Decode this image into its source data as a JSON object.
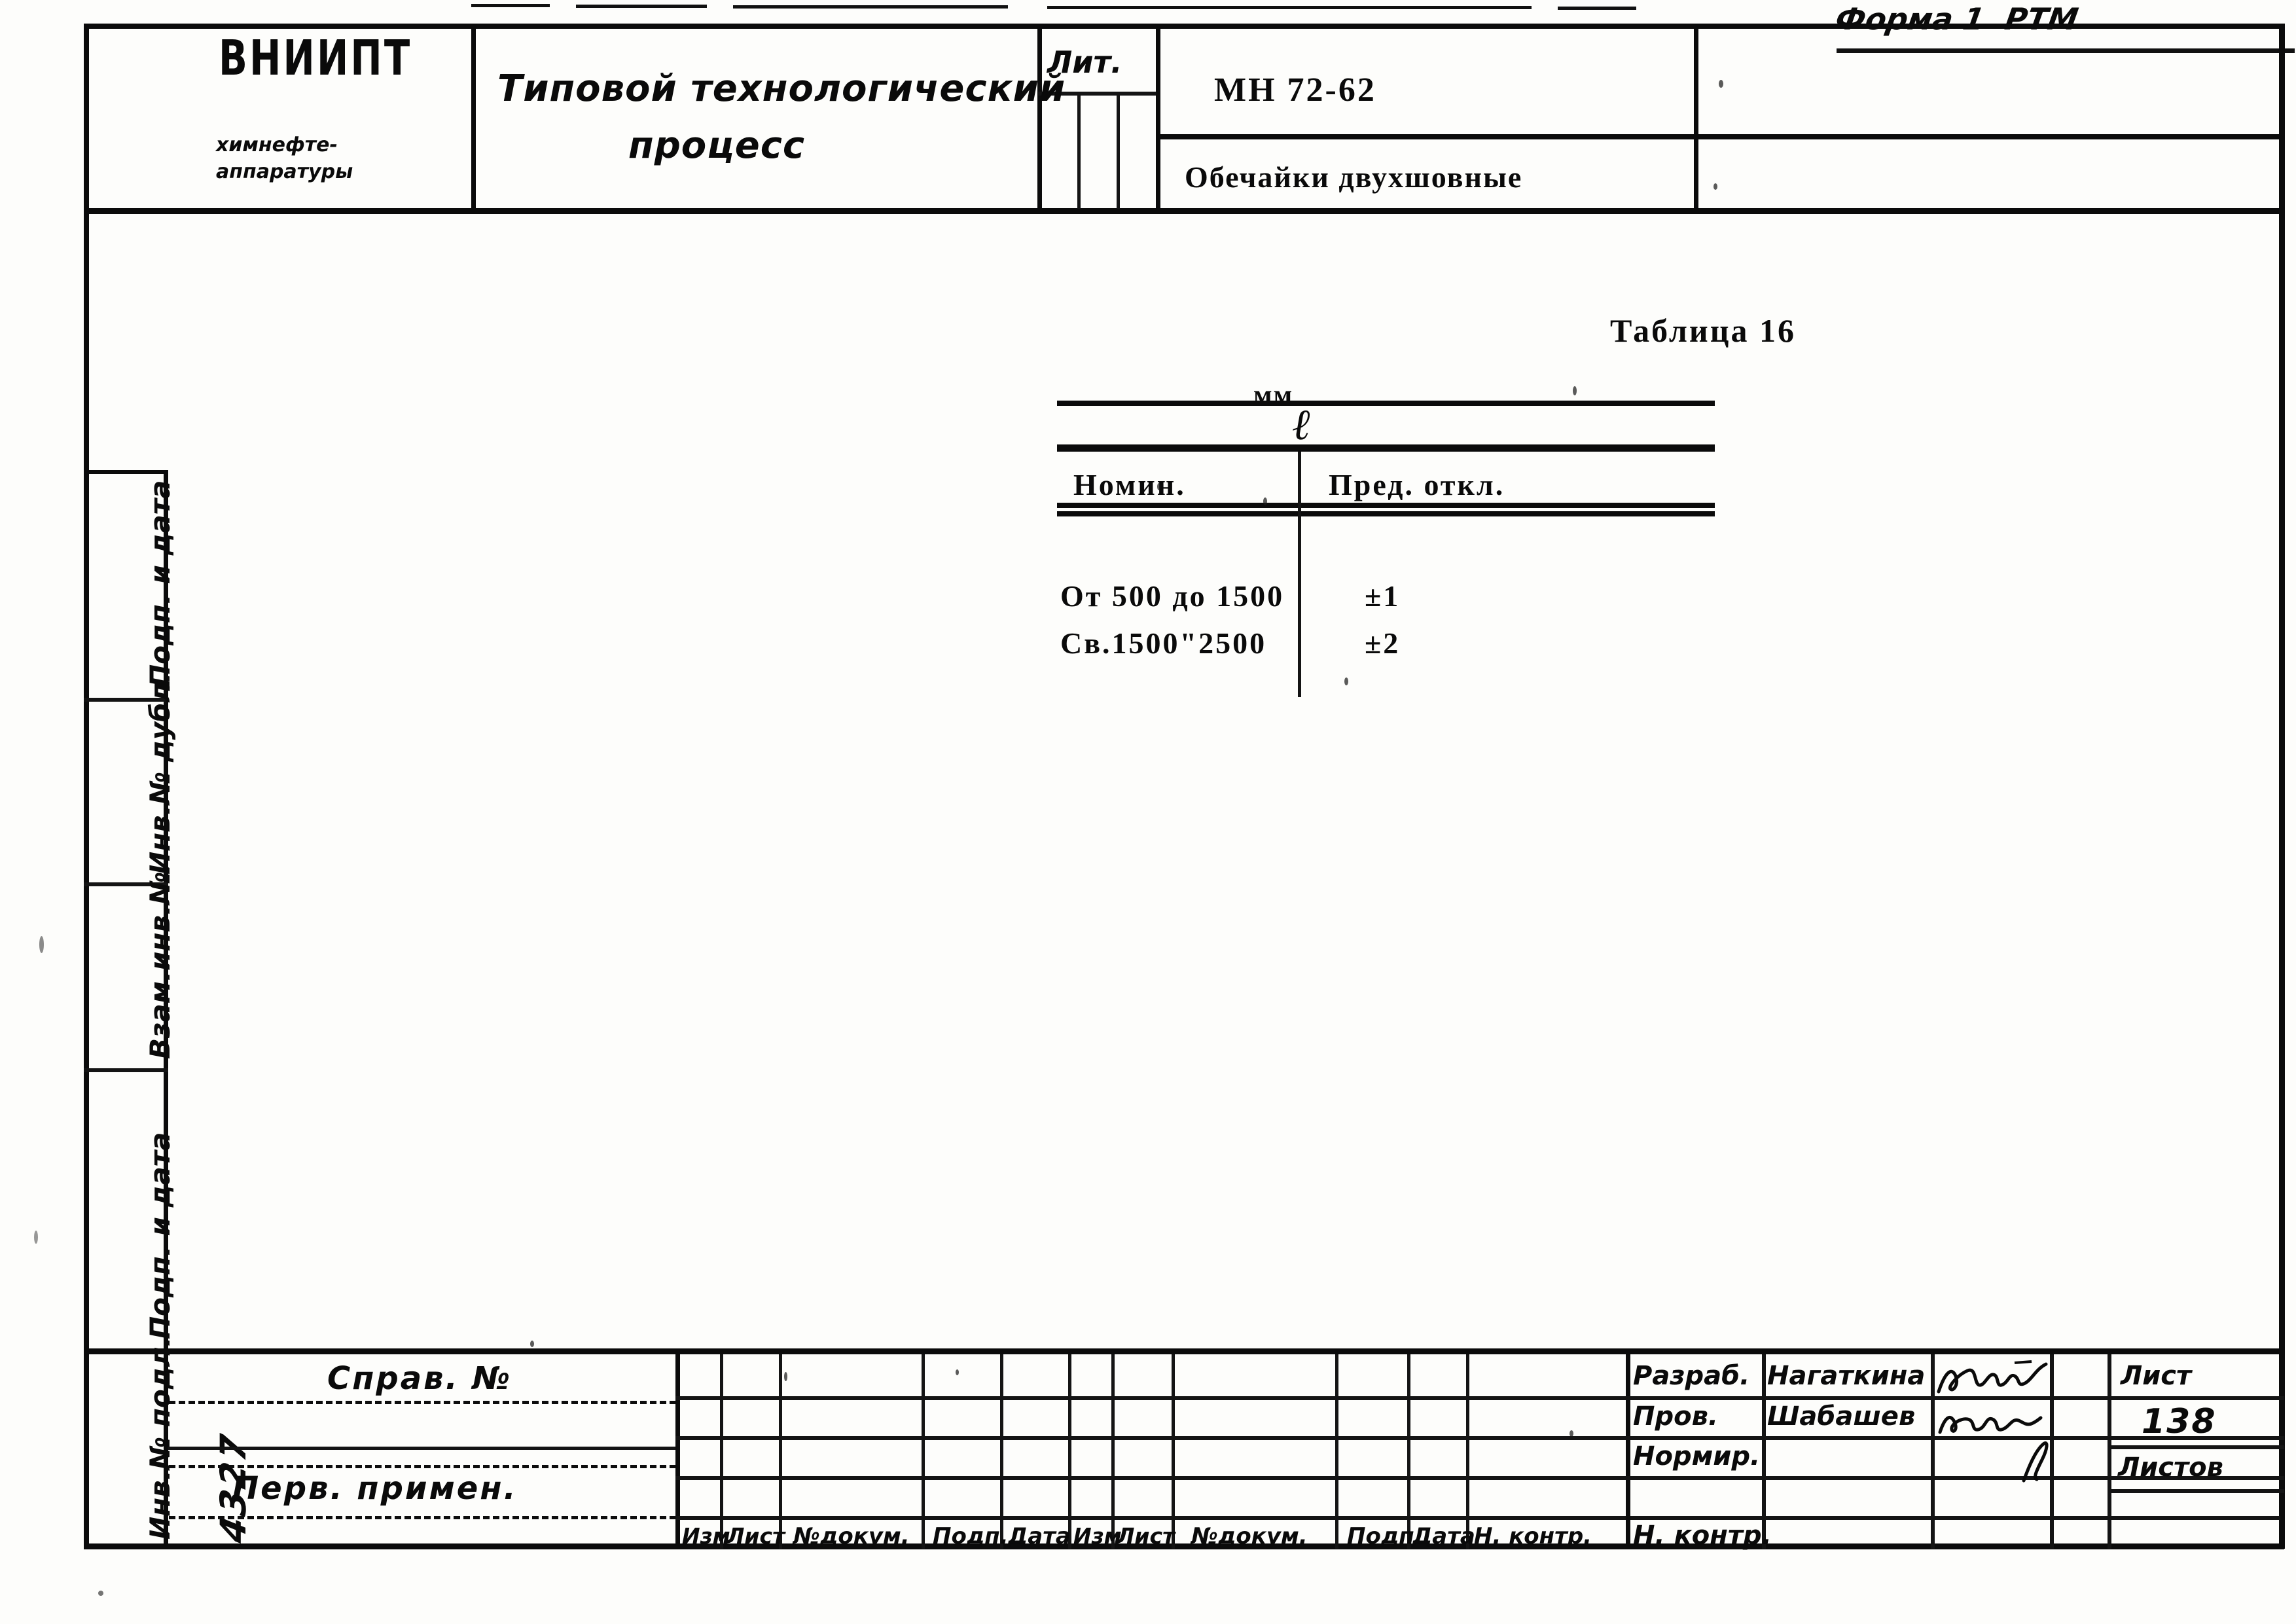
{
  "sheet": {
    "form_note": "Форма 1  РТМ"
  },
  "header": {
    "org_logo": "ВНИИПТ",
    "org_sub_line1": "химнефте-",
    "org_sub_line2": "аппаратуры",
    "doc_title_line1": "Типовой технологический",
    "doc_title_line2": "процесс",
    "lit_label": "Лит.",
    "standard_code": "МН 72-62",
    "part_name": "Обечайки двухшовные"
  },
  "table": {
    "caption": "Таблица 16",
    "unit": "мм",
    "symbol": "ℓ",
    "columns": [
      "Номин.",
      "Пред. откл."
    ],
    "rows": [
      {
        "nominal": "От 500 до 1500",
        "deviation": "±1"
      },
      {
        "nominal": "Св.1500\"2500",
        "deviation": "±2"
      }
    ]
  },
  "chart_data": {
    "type": "table",
    "title": "Таблица 16",
    "unit": "мм",
    "symbol": "ℓ",
    "columns": [
      "Номин.",
      "Пред. откл."
    ],
    "rows": [
      [
        "От 500 до 1500",
        "±1"
      ],
      [
        "Св.1500\"2500",
        "±2"
      ]
    ]
  },
  "left_margin": {
    "items": [
      "Подп. и дата",
      "Инв.№ дубл.",
      "Взам.инв.№",
      "Подп. и дата",
      "Инв.№ подл."
    ],
    "inv_number": "4327"
  },
  "bottom_left": {
    "ref_label": "Справ. №",
    "first_use_label": "Перв. примен."
  },
  "revision_strip": {
    "headers": [
      "Изм",
      "Лист",
      "№докум.",
      "Подп.",
      "Дата",
      "Изм",
      "Лист",
      "№докум.",
      "Подп.",
      "Дата",
      "Н. контр."
    ]
  },
  "signature_block": {
    "roles": [
      "Разраб.",
      "Пров.",
      "Нормир.",
      "",
      "Н. контр."
    ],
    "names": [
      "Нагаткина",
      "Шабашев",
      "",
      "",
      ""
    ],
    "sheet_label": "Лист",
    "sheet_number": "138",
    "sheets_label": "Листов"
  }
}
